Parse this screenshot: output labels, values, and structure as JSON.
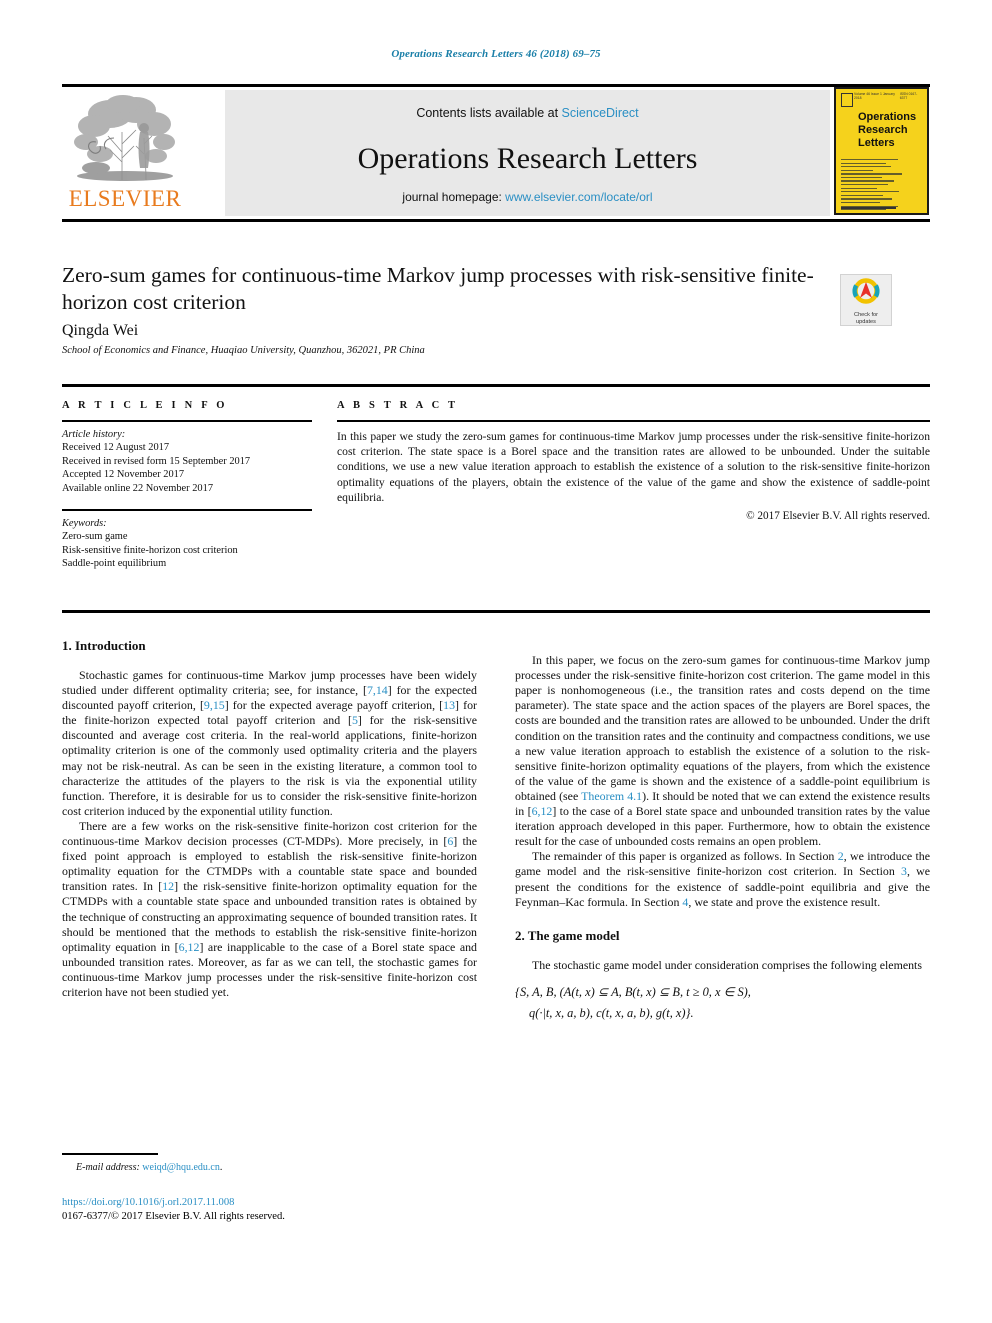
{
  "running_head": "Operations Research Letters 46 (2018) 69–75",
  "masthead": {
    "contents_prefix": "Contents lists available at ",
    "sciencedirect": "ScienceDirect",
    "journal_title": "Operations Research Letters",
    "homepage_prefix": "journal homepage: ",
    "homepage_url": "www.elsevier.com/locate/orl",
    "publisher_wordmark": "ELSEVIER",
    "cover": {
      "title_line1": "Operations",
      "title_line2": "Research",
      "title_line3": "Letters",
      "top_left": "Volume 46 Issue 1 January 2018",
      "top_right": "ISSN 0167-6377"
    }
  },
  "article": {
    "title": "Zero-sum games for continuous-time Markov jump processes with risk-sensitive finite-horizon cost criterion",
    "author": "Qingda Wei",
    "affiliation": "School of Economics and Finance, Huaqiao University, Quanzhou, 362021, PR China",
    "crossmark_line1": "Check for",
    "crossmark_line2": "updates"
  },
  "info": {
    "heading": "A R T I C L E   I N F O",
    "history_label": "Article history:",
    "history": [
      "Received 12 August 2017",
      "Received in revised form 15 September 2017",
      "Accepted 12 November 2017",
      "Available online 22 November 2017"
    ],
    "keywords_label": "Keywords:",
    "keywords": [
      "Zero-sum game",
      "Risk-sensitive finite-horizon cost criterion",
      "Saddle-point equilibrium"
    ]
  },
  "abstract": {
    "heading": "A B S T R A C T",
    "text": "In this paper we study the zero-sum games for continuous-time Markov jump processes under the risk-sensitive finite-horizon cost criterion. The state space is a Borel space and the transition rates are allowed to be unbounded. Under the suitable conditions, we use a new value iteration approach to establish the existence of a solution to the risk-sensitive finite-horizon optimality equations of the players, obtain the existence of the value of the game and show the existence of saddle-point equilibria.",
    "copyright": "© 2017 Elsevier B.V. All rights reserved."
  },
  "sections": {
    "intro_heading": "1. Introduction",
    "game_model_heading": "2. The game model"
  },
  "body": {
    "p1_a": "Stochastic games for continuous-time Markov jump processes have been widely studied under different optimality criteria; see, for instance, [",
    "p1_ref1": "7,14",
    "p1_b": "] for the expected discounted payoff criterion, [",
    "p1_ref2": "9,15",
    "p1_c": "] for the expected average payoff criterion, [",
    "p1_ref3": "13",
    "p1_d": "] for the finite-horizon expected total payoff criterion and [",
    "p1_ref4": "5",
    "p1_e": "] for the risk-sensitive discounted and average cost criteria. In the real-world applications, finite-horizon optimality criterion is one of the commonly used optimality criteria and the players may not be risk-neutral. As can be seen in the existing literature, a common tool to characterize the attitudes of the players to the risk is via the exponential utility function. Therefore, it is desirable for us to consider the risk-sensitive finite-horizon cost criterion induced by the exponential utility function.",
    "p2_a": "There are a few works on the risk-sensitive finite-horizon cost criterion for the continuous-time Markov decision processes (CT-MDPs). More precisely, in [",
    "p2_ref1": "6",
    "p2_b": "] the fixed point approach is employed to establish the risk-sensitive finite-horizon optimality equation for the CTMDPs with a countable state space and bounded transition rates. In [",
    "p2_ref2": "12",
    "p2_c": "] the risk-sensitive finite-horizon optimality equation for the CTMDPs with a countable state space and unbounded transition rates is obtained by the technique of constructing an approximating sequence of bounded transition rates. It should be mentioned that the methods to establish the risk-sensitive finite-horizon optimality equation in [",
    "p2_ref3": "6,12",
    "p2_d": "] are inapplicable to the case of a Borel state space and unbounded transition rates. Moreover, as far as we can tell, the stochastic games for continuous-time Markov jump processes under the risk-sensitive finite-horizon cost criterion have not been studied yet.",
    "p3_a": "In this paper, we focus on the zero-sum games for continuous-time Markov jump processes under the risk-sensitive finite-horizon cost criterion. The game model in this paper is nonhomogeneous (i.e., the transition rates and costs depend on the time parameter). The state space and the action spaces of the players are Borel spaces, the costs are bounded and the transition rates are allowed to be unbounded. Under the drift condition on the transition rates and the continuity and compactness conditions, we use a new value iteration approach to establish the existence of a solution to the risk-sensitive finite-horizon optimality equations of the players, from which the existence of the value of the game is shown and the existence of a saddle-point equilibrium is obtained (see ",
    "p3_thm": "Theorem 4.1",
    "p3_b": "). It should be noted that we can extend the existence results in [",
    "p3_ref1": "6,12",
    "p3_c": "] to the case of a Borel state space and unbounded transition rates by the value iteration approach developed in this paper. Furthermore, how to obtain the existence result for the case of unbounded costs remains an open problem.",
    "p4_a": "The remainder of this paper is organized as follows. In Section ",
    "p4_s2": "2",
    "p4_b": ", we introduce the game model and the risk-sensitive finite-horizon cost criterion. In Section ",
    "p4_s3": "3",
    "p4_c": ", we present the conditions for the existence of saddle-point equilibria and give the Feynman–Kac formula. In Section ",
    "p4_s4": "4",
    "p4_d": ", we state and prove the existence result.",
    "p5": "The stochastic game model under consideration comprises the following elements",
    "math_line1": "{S, A, B, (A(t, x) ⊆ A, B(t, x) ⊆ B, t ≥ 0, x ∈ S),",
    "math_line2": "q(·|t, x, a, b), c(t, x, a, b), g(t, x)}."
  },
  "footnote": {
    "label": "E-mail address:",
    "email": "weiqd@hqu.edu.cn",
    "trailing": "."
  },
  "footer": {
    "doi": "https://doi.org/10.1016/j.orl.2017.11.008",
    "issn_copyright": "0167-6377/© 2017 Elsevier B.V. All rights reserved."
  },
  "colors": {
    "link": "#2a8fc4",
    "elsevier_orange": "#E87B1E",
    "cover_yellow": "#F5D21C"
  }
}
